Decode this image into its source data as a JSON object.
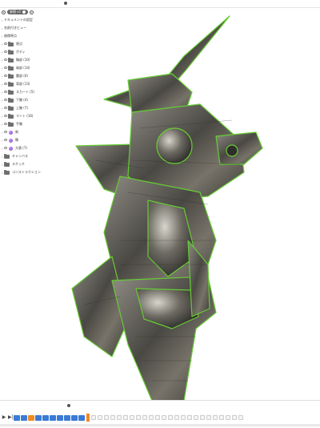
{
  "browser": {
    "root_label": "参照 v1",
    "items": [
      {
        "label": "ドキュメントの設定",
        "kind": "setting"
      },
      {
        "label": "名前付きビュー",
        "kind": "setting"
      },
      {
        "label": "座標原点",
        "kind": "setting"
      },
      {
        "label": "原点",
        "kind": "folder"
      },
      {
        "label": "ボディ",
        "kind": "folder"
      },
      {
        "label": "胸部 (10)",
        "kind": "folder"
      },
      {
        "label": "肩部 (14)",
        "kind": "folder"
      },
      {
        "label": "腰部 (6)",
        "kind": "folder"
      },
      {
        "label": "背部 (13)",
        "kind": "folder"
      },
      {
        "label": "スカート (5)",
        "kind": "folder"
      },
      {
        "label": "下腕 (4)",
        "kind": "folder"
      },
      {
        "label": "上腕 (7)",
        "kind": "folder"
      },
      {
        "label": "マント (16)",
        "kind": "folder"
      },
      {
        "label": "手腕",
        "kind": "folder"
      },
      {
        "label": "剣",
        "kind": "component"
      },
      {
        "label": "鞘",
        "kind": "component"
      },
      {
        "label": "大盾 (7)",
        "kind": "component"
      },
      {
        "label": "キャンバス",
        "kind": "folder"
      },
      {
        "label": "スケッチ",
        "kind": "folder"
      },
      {
        "label": "コンストラクション",
        "kind": "folder"
      }
    ]
  },
  "timeline": {
    "play_label": "▶",
    "end_label": "▶|",
    "feature_icons": [
      "body",
      "body",
      "sketch",
      "body",
      "body",
      "body",
      "body",
      "body",
      "body",
      "body"
    ],
    "accent_color": "#f08a24",
    "icon_color": "#3a7bd5"
  },
  "colors": {
    "model_body": "#5c5a55",
    "model_highlight": "#b9b6ae",
    "selection_outline": "#66cc33"
  }
}
